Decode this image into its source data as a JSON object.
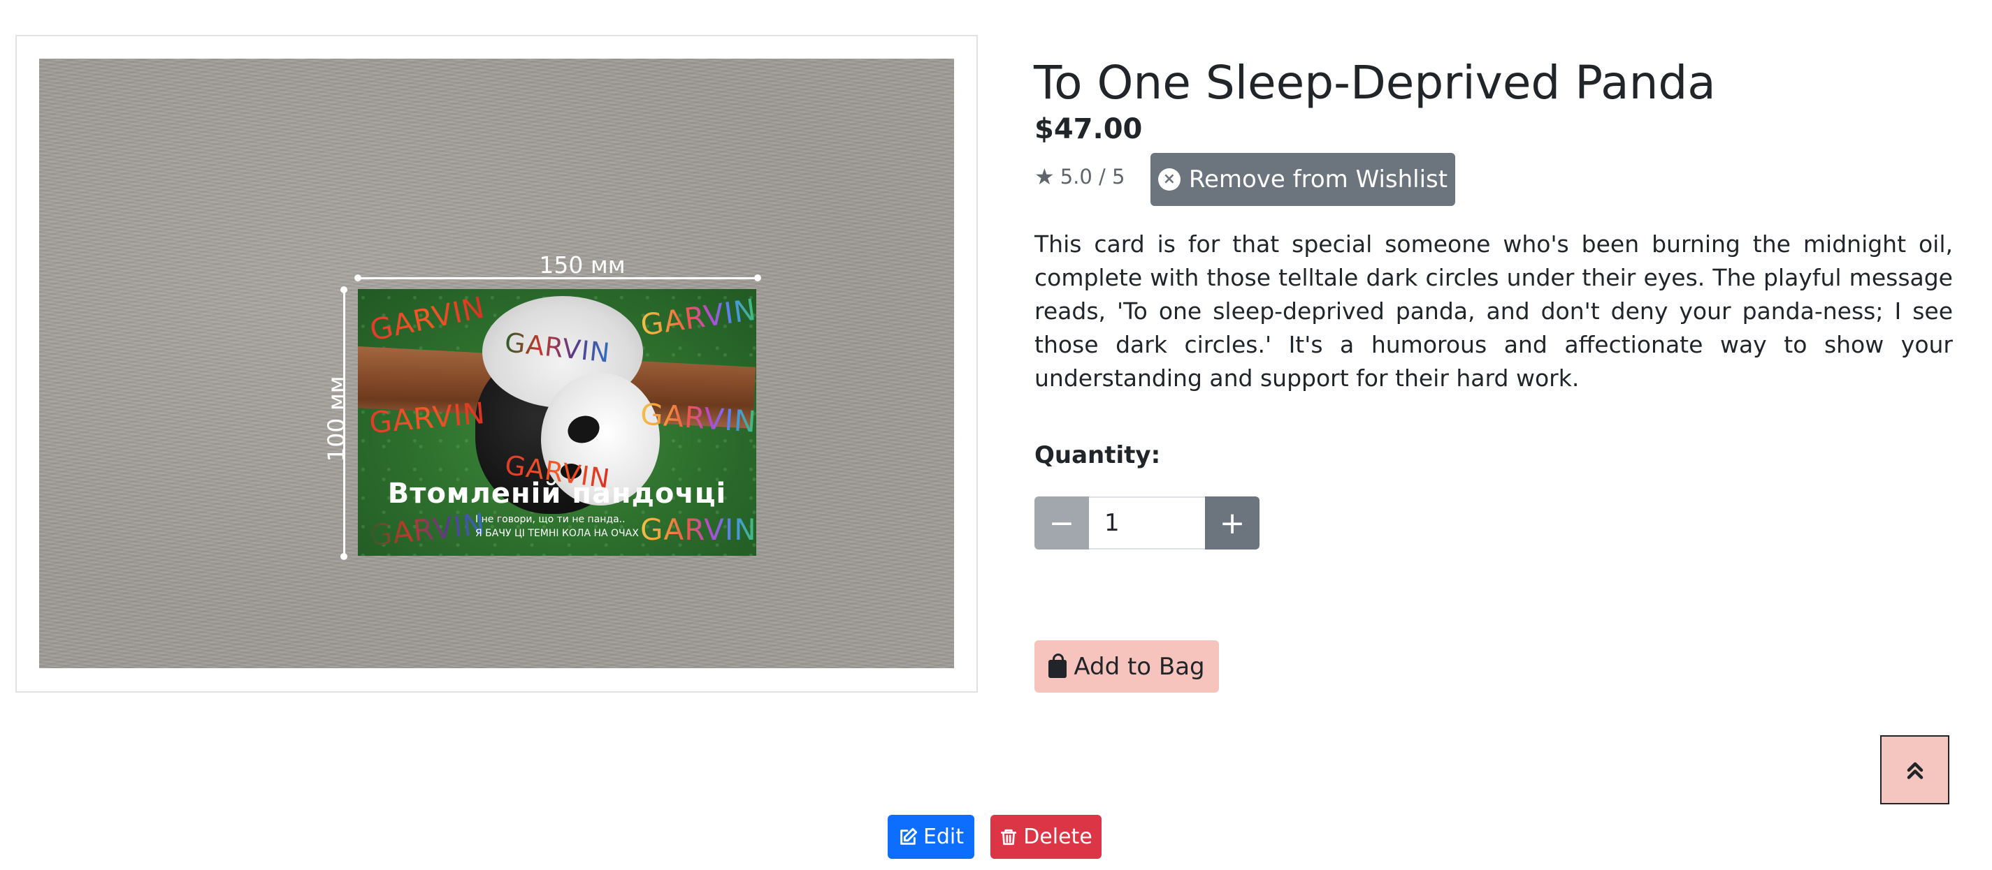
{
  "product": {
    "title": "To One Sleep-Deprived Panda",
    "price": "$47.00",
    "rating": "5.0 / 5",
    "description": "This card is for that special someone who's been burning the midnight oil, complete with those telltale dark circles under their eyes. The playful message reads, 'To one sleep-deprived panda, and don't deny your panda-ness; I see those dark circles.' It's a humorous and affectionate way to show your understanding and support for their hard work."
  },
  "image": {
    "width_label": "150 мм",
    "height_label": "100 мм",
    "card_brand": "GARVIN",
    "card_title": "Втомленій пандочці",
    "card_subtitle_line1": "І не говори, що ти не панда..",
    "card_subtitle_line2": "Я БАЧУ ЦІ ТЕМНІ КОЛА НА ОЧАХ"
  },
  "actions": {
    "wishlist_label": "Remove from Wishlist",
    "quantity_label": "Quantity:",
    "quantity_value": "1",
    "minus_symbol": "−",
    "plus_symbol": "+",
    "add_to_bag_label": "Add to Bag",
    "scroll_top_symbol": "⌃⌃"
  },
  "admin": {
    "edit_label": "Edit",
    "delete_label": "Delete"
  },
  "icons": {
    "star": "star-icon",
    "remove": "x-circle-icon",
    "bag": "bag-icon",
    "edit": "edit-icon",
    "delete": "trash-icon",
    "scroll_top": "chevrons-up-icon"
  },
  "colors": {
    "wishlist_button": "#6c757d",
    "add_to_bag_button": "#f6c4bd",
    "edit_button": "#0d6efd",
    "delete_button": "#dc3545",
    "scroll_top_button": "#f4c6bf"
  }
}
